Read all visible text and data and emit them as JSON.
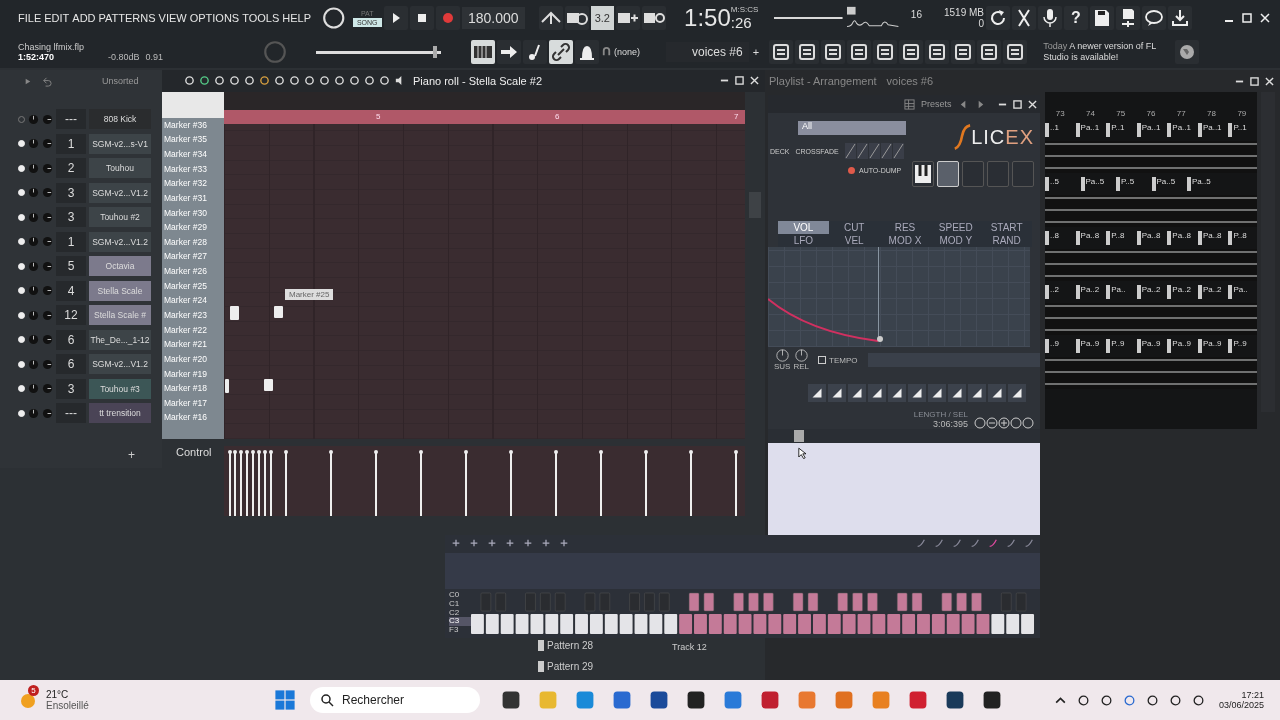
{
  "menu": [
    "FILE",
    "EDIT",
    "ADD",
    "PATTERNS",
    "VIEW",
    "OPTIONS",
    "TOOLS",
    "HELP"
  ],
  "modes": [
    {
      "label": "PAT",
      "selected": false
    },
    {
      "label": "SONG",
      "selected": true
    }
  ],
  "tempo": "180.000",
  "step": "3.2",
  "time": {
    "unit": "M:S:CS",
    "main": "1:50",
    "cs": ":26"
  },
  "monitor": {
    "cpu": "16",
    "memory": "1519 MB",
    "polyphony": "0"
  },
  "help": "?",
  "project": {
    "file": "Chasing lfmix.flp",
    "time": "1:52:470",
    "volume": "-0.80dB",
    "pitch": "0.91",
    "level": 0.97
  },
  "snap": "(none)",
  "pattern": "voices #6",
  "add": "+",
  "news": {
    "label": "Today",
    "text": "A newer version of FL Studio is available!"
  },
  "channel_rack": {
    "filter": "Unsorted",
    "add": "+",
    "channels": [
      {
        "number": "---",
        "name": "808 Kick",
        "on": false,
        "color": "#2a2c2e"
      },
      {
        "number": "1",
        "name": "SGM-v2...s-V1",
        "on": true,
        "color": "#3d4448"
      },
      {
        "number": "2",
        "name": "Touhou",
        "on": true,
        "color": "#3d4448"
      },
      {
        "number": "3",
        "name": "SGM-v2...V1.2",
        "on": true,
        "color": "#3d4448"
      },
      {
        "number": "3",
        "name": "Touhou #2",
        "on": true,
        "color": "#3d4448"
      },
      {
        "number": "1",
        "name": "SGM-v2...V1.2",
        "on": true,
        "color": "#3d4448"
      },
      {
        "number": "5",
        "name": "Octavia",
        "on": true,
        "color": "#7c7a8c"
      },
      {
        "number": "4",
        "name": "Stella Scale",
        "on": true,
        "color": "#7c7a8c"
      },
      {
        "number": "12",
        "name": "Stella Scale #",
        "on": true,
        "color": "#7c7a8c"
      },
      {
        "number": "6",
        "name": "The_De..._1-12",
        "on": true,
        "color": "#3d4448"
      },
      {
        "number": "6",
        "name": "SGM-v2...V1.2",
        "on": true,
        "color": "#3d4448"
      },
      {
        "number": "3",
        "name": "Touhou #3",
        "on": true,
        "color": "#3c5656"
      },
      {
        "number": "---",
        "name": "tt trensition",
        "on": true,
        "color": "#4a4456"
      }
    ]
  },
  "piano_roll": {
    "title": "Piano roll - Stella Scale #2",
    "bars": [
      "5",
      "6",
      "7"
    ],
    "markers": [
      "Marker #36",
      "Marker #35",
      "Marker #34",
      "Marker #33",
      "Marker #32",
      "Marker #31",
      "Marker #30",
      "Marker #29",
      "Marker #28",
      "Marker #27",
      "Marker #26",
      "Marker #25",
      "Marker #24",
      "Marker #23",
      "Marker #22",
      "Marker #21",
      "Marker #20",
      "Marker #19",
      "Marker #18",
      "Marker #17",
      "Marker #16"
    ],
    "note_label": "Marker #25",
    "control": "Control"
  },
  "playlist": {
    "title": "Playlist - Arrangement",
    "pattern": "voices #6",
    "bars": [
      "73",
      "74",
      "75",
      "76",
      "77",
      "78",
      "79"
    ],
    "rows": [
      {
        "clips": [
          "..1",
          "Pa..1",
          "P..1",
          "Pa..1",
          "Pa..1",
          "Pa..1",
          "P..1"
        ]
      },
      {
        "clips": [
          "..5",
          "Pa..5",
          "P..5",
          "Pa..5",
          "Pa..5"
        ]
      },
      {
        "clips": [
          "..8",
          "Pa..8",
          "P..8",
          "Pa..8",
          "Pa..8",
          "Pa..8",
          "P..8"
        ]
      },
      {
        "clips": [
          "..2",
          "Pa..2",
          "Pa..",
          "Pa..2",
          "Pa..2",
          "Pa..2",
          "Pa.."
        ]
      },
      {
        "clips": [
          "..9",
          "Pa..9",
          "P..9",
          "Pa..9",
          "Pa..9",
          "Pa..9",
          "P..9"
        ]
      }
    ],
    "patterns": [
      "Pattern 28",
      "Pattern 29"
    ],
    "track": "Track 12"
  },
  "slicex": {
    "presets": "Presets",
    "group": "All",
    "deck": "DECK",
    "crossfade": "CROSSFADE",
    "logo": [
      "LIC",
      "EX"
    ],
    "auto_dump": {
      "label": "AUTO-DUMP",
      "on": true
    },
    "tabs": [
      {
        "label": "VOL",
        "selected": true
      },
      {
        "label": "CUT",
        "selected": false
      },
      {
        "label": "RES",
        "selected": false
      },
      {
        "label": "SPEED",
        "selected": false
      },
      {
        "label": "START",
        "selected": false
      },
      {
        "label": "LFO",
        "selected": false
      },
      {
        "label": "VEL",
        "selected": false
      },
      {
        "label": "MOD X",
        "selected": false
      },
      {
        "label": "MOD Y",
        "selected": false
      },
      {
        "label": "RAND",
        "selected": false
      }
    ],
    "knobs": [
      "SUS",
      "REL"
    ],
    "tempo": "TEMPO",
    "tempo_on": false,
    "length_label": "LENGTH / SEL",
    "length": "3:06:395"
  },
  "keyboard": {
    "labels": [
      {
        "label": "C0",
        "selected": false
      },
      {
        "label": "C1",
        "selected": false
      },
      {
        "label": "C2",
        "selected": false
      },
      {
        "label": "C3",
        "selected": true
      },
      {
        "label": "F3",
        "selected": false
      }
    ]
  },
  "taskbar": {
    "temperature": "21°C",
    "weather": "Ensoleillé",
    "badge": "5",
    "search": "Rechercher",
    "time": "17:21",
    "date": "03/06/2025"
  }
}
